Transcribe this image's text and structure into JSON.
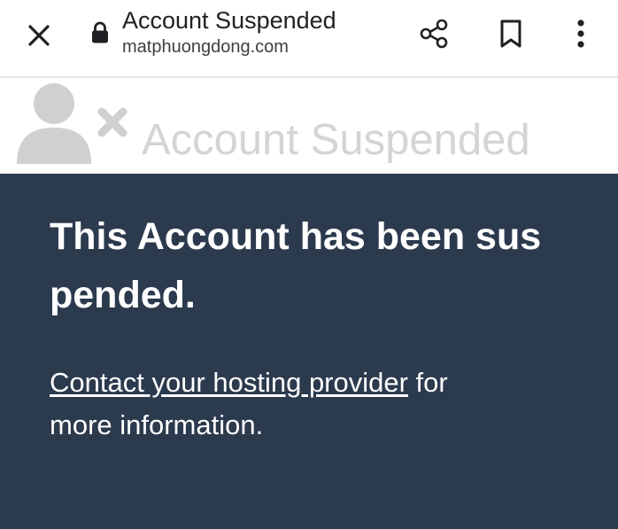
{
  "toolbar": {
    "title": "Account Suspended",
    "url": "matphuongdong.com",
    "icons": {
      "close": "close-icon",
      "lock": "lock-icon",
      "share": "share-icon",
      "bookmark": "bookmark-icon",
      "menu": "more-vert-icon"
    }
  },
  "header": {
    "icon": "user-suspended-icon",
    "heading": "Account Suspended"
  },
  "main": {
    "heading_part1": "This Account has been sus",
    "heading_part2": "pended.",
    "link_text": "Contact your hosting provider",
    "after_link": " for",
    "line2": "more information."
  },
  "colors": {
    "panel_background": "#2c3a4e",
    "header_text": "#d4d4d4",
    "icon_gray": "#d0d0d0",
    "main_text": "#ffffff"
  }
}
